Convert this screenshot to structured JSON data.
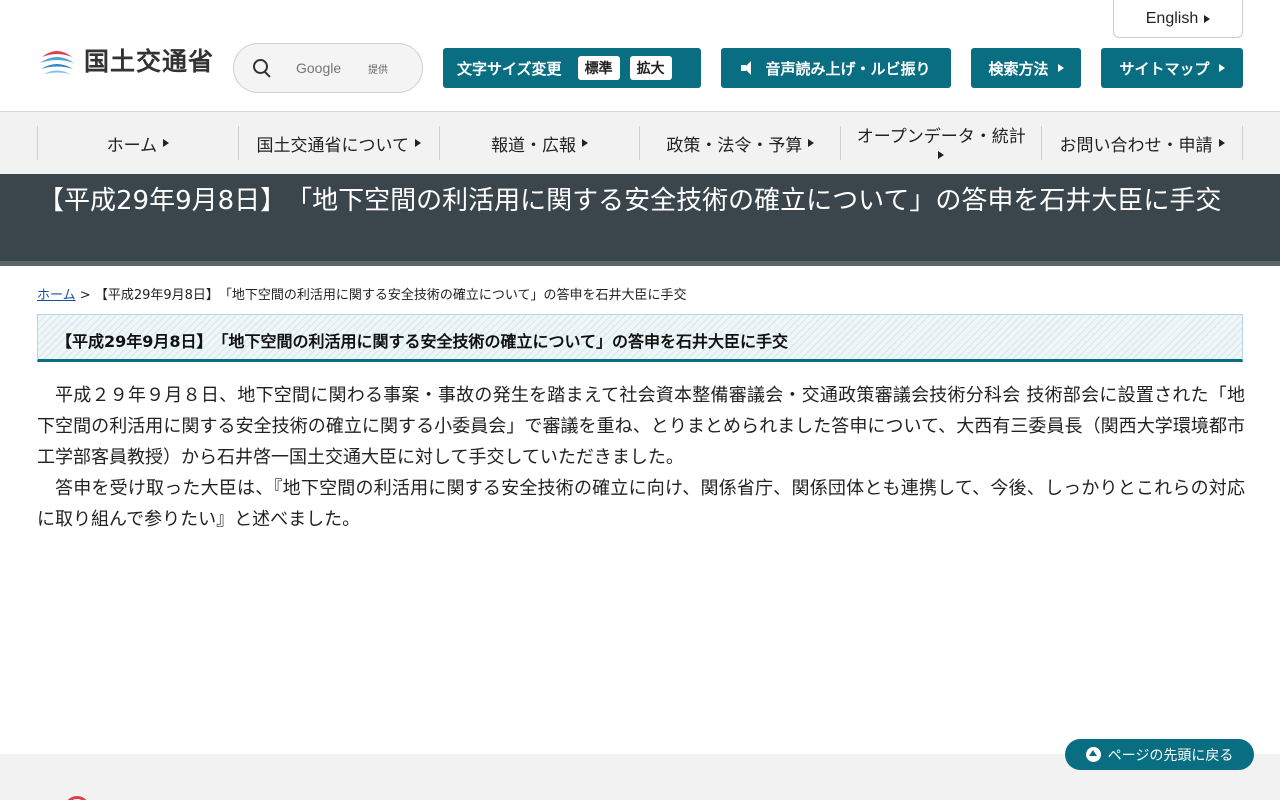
{
  "header": {
    "logo_text": "国土交通省",
    "english_label": "English",
    "search": {
      "placeholder": "Google",
      "provided": "提供"
    },
    "font_size": {
      "label": "文字サイズ変更",
      "standard": "標準",
      "large": "拡大"
    },
    "voice_label": "音声読み上げ・ルビ振り",
    "search_method_label": "検索方法",
    "sitemap_label": "サイトマップ"
  },
  "gnav": {
    "items": [
      {
        "label": "ホーム"
      },
      {
        "label": "国土交通省について"
      },
      {
        "label": "報道・広報"
      },
      {
        "label": "政策・法令・予算"
      },
      {
        "label": "オープンデータ・統計"
      },
      {
        "label": "お問い合わせ・申請"
      }
    ]
  },
  "page": {
    "title": "【平成29年9月8日】　「地下空間の利活用に関する安全技術の確立について」の答申を石井大臣に手交",
    "breadcrumb": {
      "home": "ホーム",
      "separator": ">",
      "current": "【平成29年9月8日】　「地下空間の利活用に関する安全技術の確立について」の答申を石井大臣に手交"
    },
    "heading": "【平成29年9月8日】　「地下空間の利活用に関する安全技術の確立について」の答申を石井大臣に手交",
    "paragraphs": [
      "平成２９年９月８日、地下空間に関わる事案・事故の発生を踏まえて社会資本整備審議会・交通政策審議会技術分科会 技術部会に設置された「地下空間の利活用に関する安全技術の確立に関する小委員会」で審議を重ね、とりまとめられました答申について、大西有三委員長（関西大学環境都市工学部客員教授）から石井啓一国土交通大臣に対して手交していただきました。",
      "答申を受け取った大臣は、『地下空間の利活用に関する安全技術の確立に向け、関係省庁、関係団体とも連携して、今後、しっかりとこれらの対応に取り組んで参りたい』と述べました。"
    ]
  },
  "footer": {
    "back_to_top": "ページの先頭に戻る"
  },
  "colors": {
    "accent": "#0a6e82",
    "title_band": "#3a464b",
    "nav_bg": "#f2f2f2"
  }
}
